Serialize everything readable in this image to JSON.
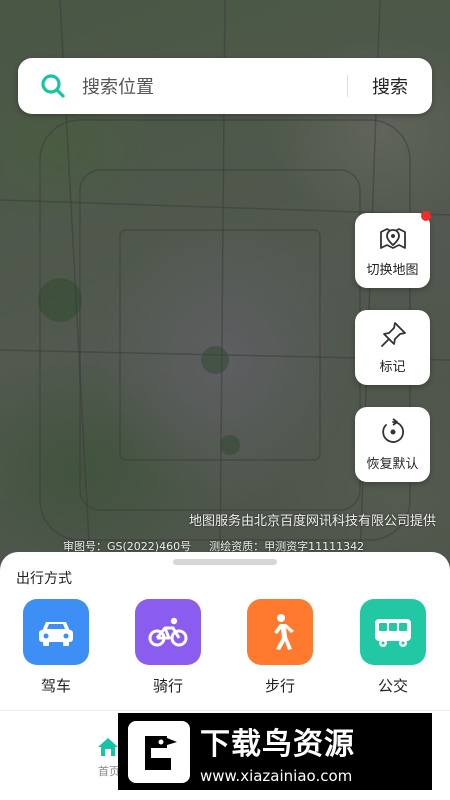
{
  "search": {
    "placeholder": "搜索位置",
    "button_label": "搜索"
  },
  "side_buttons": [
    {
      "label": "切换地图",
      "icon": "map-pin-icon"
    },
    {
      "label": "标记",
      "icon": "pushpin-icon"
    },
    {
      "label": "恢复默认",
      "icon": "reset-icon"
    }
  ],
  "map": {
    "attribution": "地图服务由北京百度网讯科技有限公司提供",
    "review_number": "审图号：GS(2022)460号",
    "survey_license": "测绘资质：甲测资字11111342"
  },
  "travel": {
    "title": "出行方式",
    "modes": [
      {
        "label": "驾车",
        "icon": "car-icon",
        "color": "#3d8ef5"
      },
      {
        "label": "骑行",
        "icon": "bicycle-icon",
        "color": "#8a5cf0"
      },
      {
        "label": "步行",
        "icon": "walk-icon",
        "color": "#ff7a2e"
      },
      {
        "label": "公交",
        "icon": "bus-icon",
        "color": "#22c7a4"
      }
    ]
  },
  "tabbar": {
    "home_label": "首页"
  },
  "watermark": {
    "title": "下载鸟资源",
    "url": "www.xiazainiao.com"
  },
  "colors": {
    "accent": "#19c4a6",
    "red_dot": "#f02b2b"
  }
}
